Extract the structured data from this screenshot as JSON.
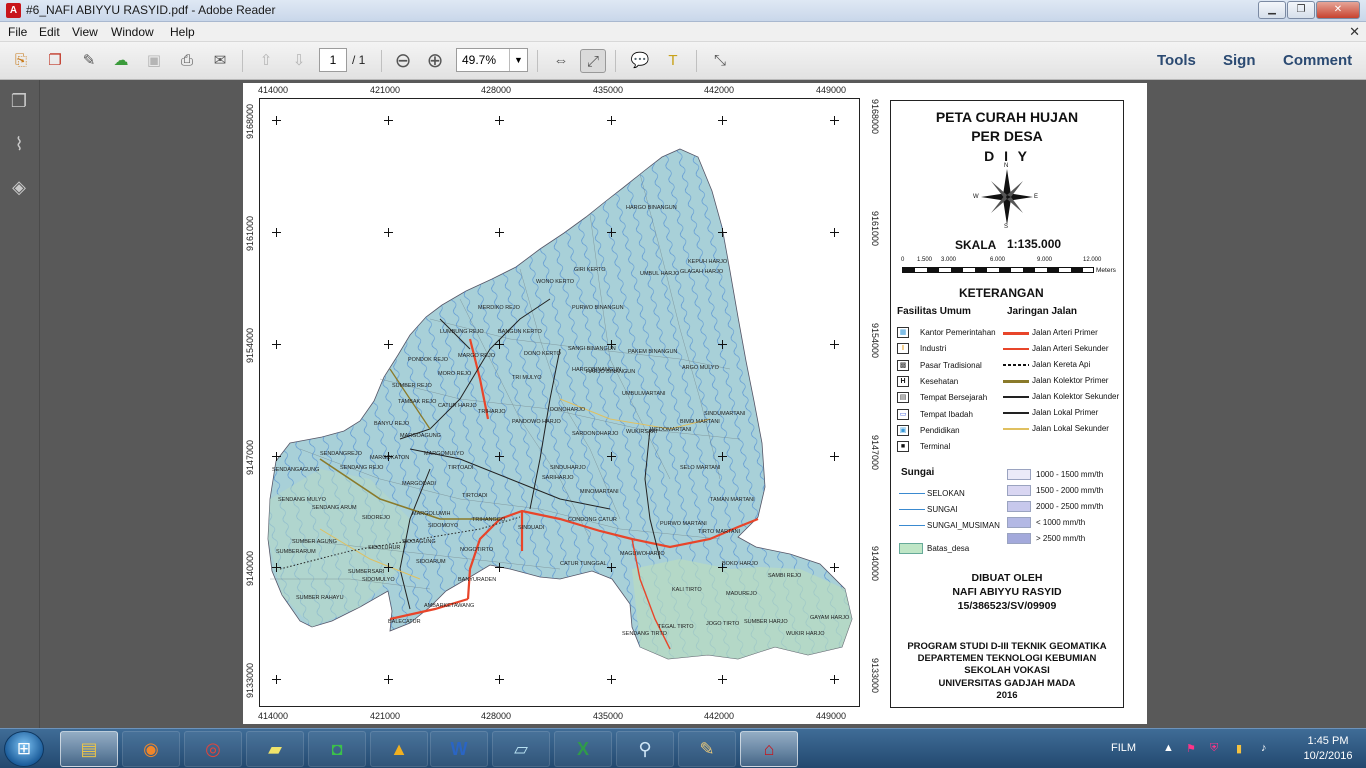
{
  "window": {
    "title": "#6_NAFI ABIYYU RASYID.pdf - Adobe Reader",
    "minimize": "▁",
    "restore": "❐",
    "close": "✕"
  },
  "menu": {
    "file": "File",
    "edit": "Edit",
    "view": "View",
    "window": "Window",
    "help": "Help"
  },
  "toolbar": {
    "page_current": "1",
    "page_total": "/ 1",
    "zoom": "49.7%",
    "tools": "Tools",
    "sign": "Sign",
    "comment": "Comment"
  },
  "map": {
    "x_ticks": [
      "414000",
      "421000",
      "428000",
      "435000",
      "442000",
      "449000"
    ],
    "y_ticks": [
      "9168000",
      "9161000",
      "9154000",
      "9147000",
      "9140000",
      "9133000"
    ],
    "villages": [
      "HARGO BINANGUN",
      "GIRI KERTO",
      "KEPUH HARJO",
      "UMBUL HARJO",
      "GLAGAH HARJO",
      "WONO KERTO",
      "PURWO BINANGUN",
      "MERDIKO REJO",
      "LUMBUNG REJO",
      "BANGUN KERTO",
      "DONO KERTO",
      "SANGI BINANGUN",
      "PAKEM BINANGUN",
      "HARGOBINANGUN",
      "ARGO MULYO",
      "PONDOK REJO",
      "MARGO REJO",
      "MORO REJO",
      "TRI MULYO",
      "HARJO BINANGUN",
      "SUMBER REJO",
      "CATUR HARJO",
      "UMBULMARTANI",
      "TAMBAK REJO",
      "TRIHARJO",
      "DONOHARJO",
      "BIMO MARTANI",
      "SINDUMARTANI",
      "BANYU REJO",
      "PANDOWO HARJO",
      "SARDONOHARJO",
      "WUKIRSARI",
      "WEDOMARTANI",
      "MARGOAGUNG",
      "MARGOKATON",
      "MARGOMULYO",
      "TIRTOADI",
      "SINDUHARJO",
      "SELO MARTANI",
      "SENDANGREJO",
      "SENDANGAGUNG",
      "SENDANG REJO",
      "MARGODADI",
      "TIRTOADI",
      "SARIHARJO",
      "MINOMARTANI",
      "TAMAN MARTANI",
      "SENDANG MULYO",
      "SENDANG ARUM",
      "SIDOREJO",
      "MARGOLUWIH",
      "SIDOMOYO",
      "TRIHANGGO",
      "SINDUADI",
      "CONDONG CATUR",
      "PURWO MARTANI",
      "TIRTO MARTANI",
      "SUMBER AGUNG",
      "SIDOAGUNG",
      "NOGOTIRTO",
      "MAGUWOHARJO",
      "SIDOLUHUR",
      "SIDOARUM",
      "SUMBERARUM",
      "CATUR TUNGGAL",
      "SUMBERSARI",
      "SIDOMULYO",
      "BANYURADEN",
      "KALI TIRTO",
      "MADUREJO",
      "SAMBI REJO",
      "SUMBER RAHAYU",
      "AMBARKETAWANG",
      "BALECATUR",
      "TEGAL TIRTO",
      "JOGO TIRTO",
      "SUMBER HARJO",
      "GAYAM HARJO",
      "WUKIR HARJO",
      "SENDANG TIRTO",
      "BOKO HARJO"
    ]
  },
  "legend": {
    "title_1": "PETA CURAH HUJAN",
    "title_2": "PER DESA",
    "title_3": "D I Y",
    "north": "N",
    "south": "S",
    "east": "E",
    "west": "W",
    "scale_label": "SKALA",
    "scale_value": "1:135.000",
    "scale_ticks": [
      "0",
      "1.500",
      "3.000",
      "6.000",
      "9.000",
      "12.000"
    ],
    "scale_unit": "Meters",
    "keterangan": "KETERANGAN",
    "fasilitas_header": "Fasilitas Umum",
    "jaringan_header": "Jaringan Jalan",
    "fasilitas": [
      "Kantor Pemerintahan",
      "Industri",
      "Pasar Tradisional",
      "Kesehatan",
      "Tempat Bersejarah",
      "Tempat Ibadah",
      "Pendidikan",
      "Terminal"
    ],
    "jalan": [
      "Jalan Arteri Primer",
      "Jalan Arteri Sekunder",
      "Jalan Kereta Api",
      "Jalan Kolektor Primer",
      "Jalan Kolektor Sekunder",
      "Jalan Lokal Primer",
      "Jalan Lokal Sekunder"
    ],
    "jalan_colors": [
      "#e8452a",
      "#e8452a",
      "#222222",
      "#8a7a2a",
      "#222222",
      "#222222",
      "#e0c060"
    ],
    "sungai_header": "Sungai",
    "sungai": [
      "SELOKAN",
      "SUNGAI",
      "SUNGAI_MUSIMAN"
    ],
    "batas": "Batas_desa",
    "rain": [
      "1000 - 1500 mm/th",
      "1500 - 2000 mm/th",
      "2000 - 2500 mm/th",
      "< 1000 mm/th",
      "> 2500 mm/th"
    ],
    "rain_colors": [
      "#ebeaf8",
      "#d9d6f2",
      "#c7c8ec",
      "#b3b8e4",
      "#a3a9db"
    ],
    "dibuat_oleh": "DIBUAT OLEH",
    "author": "NAFI ABIYYU RASYID",
    "nim": "15/386523/SV/09909",
    "inst_1": "PROGRAM STUDI D-III TEKNIK GEOMATIKA",
    "inst_2": "DEPARTEMEN TEKNOLOGI KEBUMIAN",
    "inst_3": "SEKOLAH VOKASI",
    "inst_4": "UNIVERSITAS GADJAH MADA",
    "year": "2016"
  },
  "taskbar": {
    "apps": [
      "Windows Explorer",
      "Firefox",
      "Chrome",
      "Sticky Notes",
      "LINE",
      "ArchiCAD",
      "Word",
      "Notepad",
      "Excel",
      "Magnifier",
      "Paint",
      "Adobe Reader"
    ],
    "tray_label": "FILM",
    "time": "1:45 PM",
    "date": "10/2/2016"
  }
}
